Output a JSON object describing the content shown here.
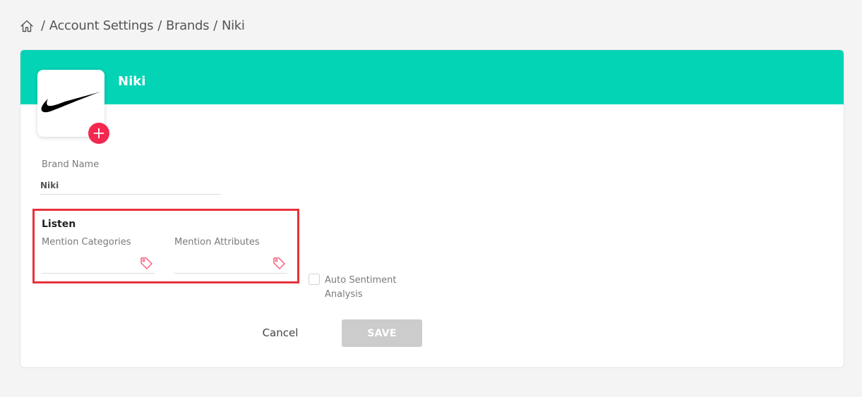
{
  "breadcrumb": {
    "items": [
      "Account Settings",
      "Brands",
      "Niki"
    ],
    "separator": "/"
  },
  "brand": {
    "title": "Niki",
    "name_label": "Brand Name",
    "name_value": "Niki"
  },
  "listen": {
    "title": "Listen",
    "mention_categories_label": "Mention Categories",
    "mention_attributes_label": "Mention Attributes",
    "mention_categories_value": "",
    "mention_attributes_value": ""
  },
  "auto_sentiment": {
    "label": "Auto Sentiment Analysis",
    "checked": false
  },
  "actions": {
    "cancel_label": "Cancel",
    "save_label": "SAVE"
  },
  "colors": {
    "header": "#03d4b6",
    "add_button": "#f4274f",
    "highlight": "#e8323e",
    "save_disabled": "#cccccc"
  },
  "icons": {
    "home": "home-icon",
    "add": "plus-icon",
    "tag": "tag-icon",
    "logo": "swoosh-logo"
  }
}
